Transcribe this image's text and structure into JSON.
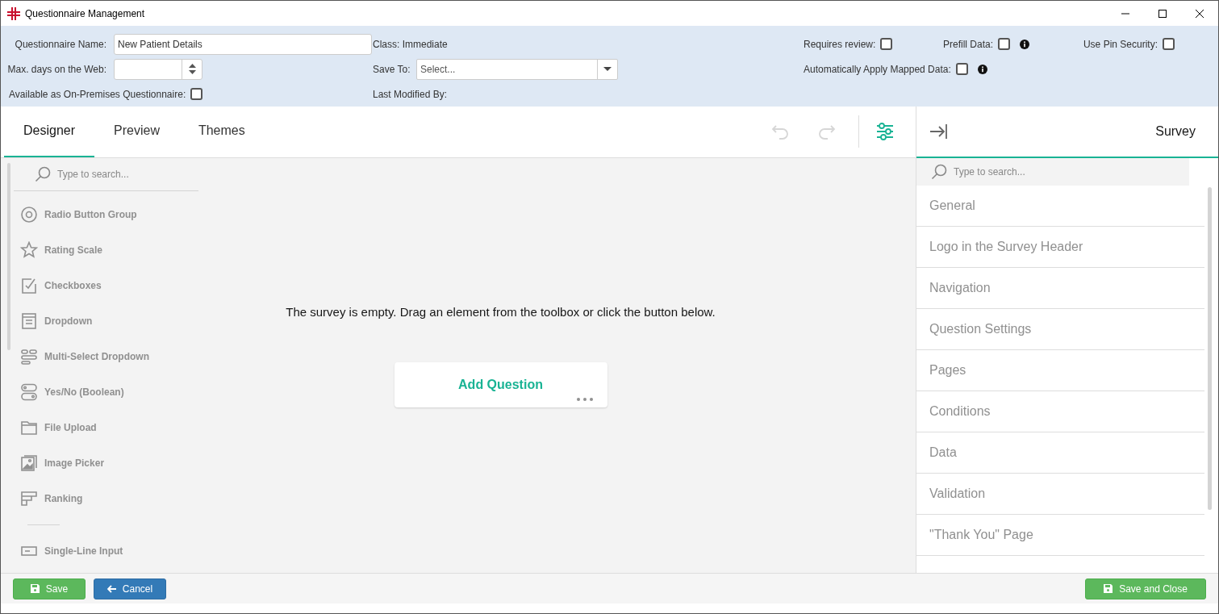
{
  "window": {
    "title": "Questionnaire Management"
  },
  "form": {
    "columns": [
      {
        "fields": [
          {
            "kind": "text",
            "label": "Questionnaire Name:",
            "value": "New Patient Details"
          },
          {
            "kind": "spinner",
            "label": "Max. days on the Web:"
          },
          {
            "kind": "checkbox",
            "label": "Available as On-Premises Questionnaire:",
            "checked": false
          }
        ]
      },
      {
        "fields": [
          {
            "kind": "label",
            "label": "Class: Immediate"
          },
          {
            "kind": "select",
            "label": "Save To:",
            "placeholder": "Select..."
          },
          {
            "kind": "label",
            "label": "Last Modified By:"
          }
        ]
      }
    ],
    "options": [
      [
        {
          "label": "Requires review:",
          "checked": false,
          "info": false
        },
        {
          "label": "Prefill Data:",
          "checked": false,
          "info": true
        },
        {
          "label": "Use Pin Security:",
          "checked": false,
          "info": false
        }
      ],
      [
        {
          "label": "Automatically Apply Mapped Data:",
          "checked": false,
          "info": true
        }
      ]
    ]
  },
  "tabs": [
    {
      "label": "Designer",
      "selected": true
    },
    {
      "label": "Preview",
      "selected": false
    },
    {
      "label": "Themes",
      "selected": false
    }
  ],
  "toolbar": {
    "undo": {
      "disabled": true
    },
    "redo": {
      "disabled": true
    },
    "settings": {
      "selected": true
    }
  },
  "toolbox": {
    "search": {
      "placeholder": "Type to search..."
    },
    "groups": [
      {
        "items": [
          {
            "kind": "radio",
            "label": "Radio Button Group"
          },
          {
            "kind": "rating",
            "label": "Rating Scale"
          },
          {
            "kind": "checkbox",
            "label": "Checkboxes"
          },
          {
            "kind": "dropdown",
            "label": "Dropdown"
          },
          {
            "kind": "multiselect",
            "label": "Multi-Select Dropdown"
          },
          {
            "kind": "boolean",
            "label": "Yes/No (Boolean)"
          },
          {
            "kind": "file",
            "label": "File Upload"
          },
          {
            "kind": "image",
            "label": "Image Picker"
          },
          {
            "kind": "ranking",
            "label": "Ranking"
          }
        ]
      },
      {
        "items": [
          {
            "kind": "text",
            "label": "Single-Line Input"
          }
        ]
      }
    ]
  },
  "canvas": {
    "message": "The survey is empty. Drag an element from the toolbox or click the button below.",
    "add_button": "Add Question"
  },
  "properties": {
    "title": "Survey",
    "search": {
      "placeholder": "Type to search..."
    },
    "categories": [
      "General",
      "Logo in the Survey Header",
      "Navigation",
      "Question Settings",
      "Pages",
      "Conditions",
      "Data",
      "Validation",
      "\"Thank You\" Page"
    ]
  },
  "footer": {
    "save": "Save",
    "cancel": "Cancel",
    "save_close": "Save and Close"
  }
}
